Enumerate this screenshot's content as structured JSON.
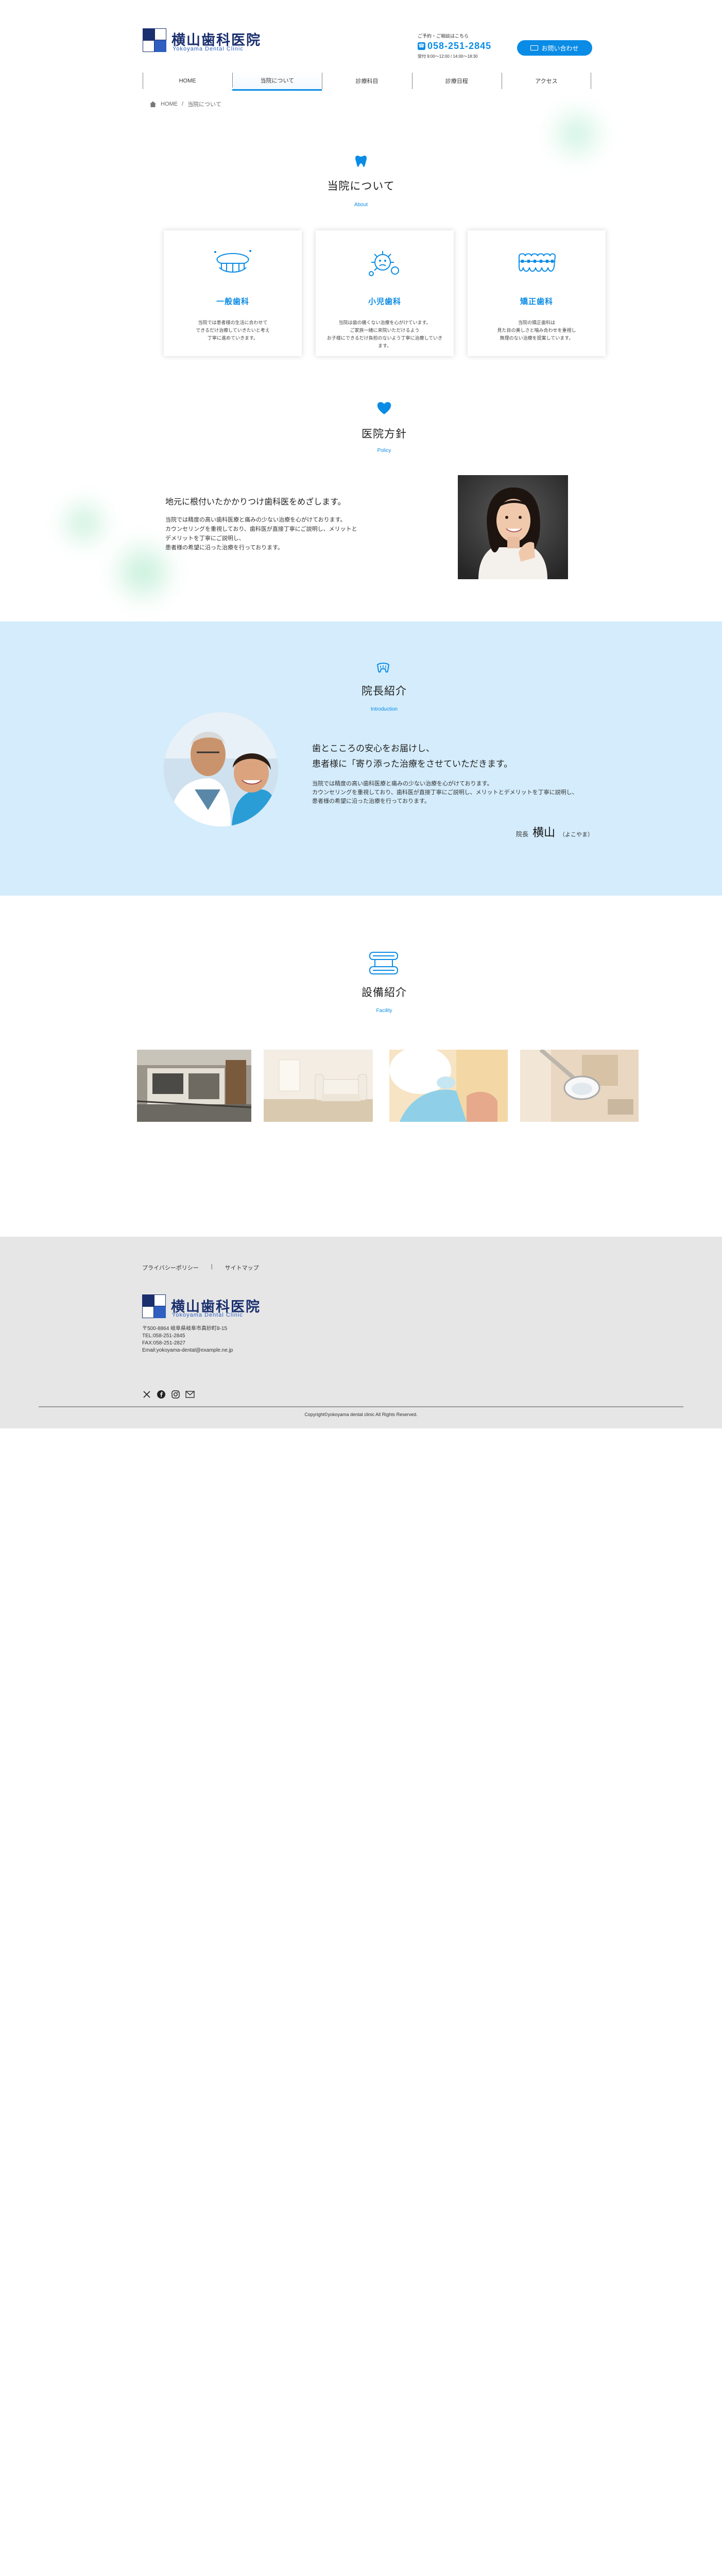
{
  "brand": {
    "name": "横山歯科医院",
    "subtitle": "Yokoyama Dental Clinic",
    "primary_color": "#0a8ce6",
    "logo_color": "#1a2f6e"
  },
  "header": {
    "tel_note": "ご予約・ご相談はこちら",
    "tel_number": "058-251-2845",
    "hours": "受付 9:00〜12:00 / 14:00〜18:30",
    "contact_label": "お問い合わせ"
  },
  "nav": {
    "items": [
      {
        "label": "HOME"
      },
      {
        "label": "当院について"
      },
      {
        "label": "診療科目"
      },
      {
        "label": "診療日程"
      },
      {
        "label": "アクセス"
      }
    ]
  },
  "breadcrumb": {
    "home": "HOME",
    "separator": "/",
    "current": "当院について"
  },
  "about": {
    "title": "当院について",
    "en": "About",
    "cards": [
      {
        "title": "一般歯科",
        "lines": [
          "当院では患者様の生活に合わせて",
          "できるだけ治療していきたいと考え",
          "丁寧に進めていきます。"
        ]
      },
      {
        "title": "小児歯科",
        "lines": [
          "当院は歯の痛くない治療を心がけています。",
          "ご家族一緒に来院いただけるよう",
          "お子様にできるだけ負担のないよう丁寧に治療していきます。"
        ]
      },
      {
        "title": "矯正歯科",
        "lines": [
          "当院の矯正歯科は",
          "見た目の美しさと噛み合わせを重視し",
          "無理のない治療を提案しています。"
        ]
      }
    ]
  },
  "policy": {
    "title": "医院方針",
    "en": "Policy",
    "heading": "地元に根付いたかかりつけ歯科医をめざします。",
    "lines": [
      "当院では精度の高い歯科医療と痛みの少ない治療を心がけております。",
      "カウンセリングを重視しており、歯科医が直接丁寧にご説明し、メリットとデメリットを丁寧にご説明し、",
      "患者様の希望に沿った治療を行っております。"
    ]
  },
  "director": {
    "title": "院長紹介",
    "en": "Introduction",
    "message_lines": [
      "歯とこころの安心をお届けし、",
      "患者様に「寄り添った治療をさせていただきます。"
    ],
    "body_lines": [
      "当院では精度の高い歯科医療と痛みの少ない治療を心がけております。",
      "カウンセリングを重視しており、歯科医が直接丁寧にご説明し、メリットとデメリットを丁寧に説明し、",
      "患者様の希望に沿った治療を行っております。"
    ],
    "role": "院長",
    "name": "横山",
    "reading": "（よこやま）"
  },
  "facility": {
    "title": "設備紹介",
    "en": "Facility"
  },
  "footer": {
    "links": [
      "プライバシーポリシー",
      "サイトマップ"
    ],
    "link_separator": "|",
    "address_lines": [
      "〒500-8864 岐阜県岐阜市真砂町8-15",
      "TEL:058-251-2845",
      "FAX:058-251-2827",
      "Email:yokoyama-dental@example.ne.jp"
    ],
    "copyright": "Copyright©yokoyama dental clinic All Rights Reserved."
  },
  "icons": [
    "tooth-icon",
    "heart-icon",
    "phone-icon",
    "mail-icon",
    "home-icon",
    "x-icon",
    "facebook-icon",
    "instagram-icon"
  ]
}
